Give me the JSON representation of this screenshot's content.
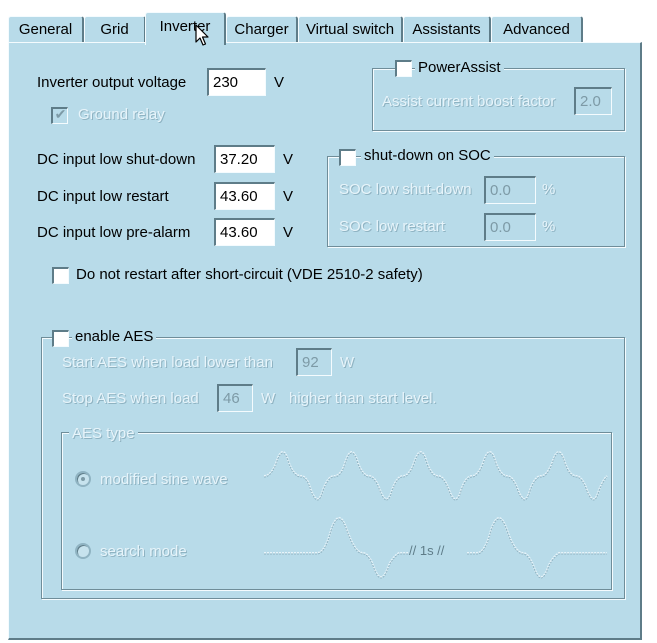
{
  "tabs": [
    {
      "label": "General"
    },
    {
      "label": "Grid"
    },
    {
      "label": "Inverter"
    },
    {
      "label": "Charger"
    },
    {
      "label": "Virtual switch"
    },
    {
      "label": "Assistants"
    },
    {
      "label": "Advanced"
    }
  ],
  "active_tab": "Inverter",
  "inverter": {
    "output_voltage_label": "Inverter output voltage",
    "output_voltage_value": "230",
    "output_voltage_unit": "V",
    "ground_relay_label": "Ground relay",
    "dc_shutdown_label": "DC input low shut-down",
    "dc_shutdown_value": "37.20",
    "dc_restart_label": "DC input low restart",
    "dc_restart_value": "43.60",
    "dc_prealarm_label": "DC input low pre-alarm",
    "dc_prealarm_value": "43.60",
    "dc_unit": "V",
    "no_restart_label": "Do not restart after short-circuit (VDE 2510-2  safety)"
  },
  "power_assist": {
    "label": "PowerAssist",
    "boost_label": "Assist current boost factor",
    "boost_value": "2.0"
  },
  "soc": {
    "label": "shut-down on SOC",
    "low_shutdown_label": "SOC low shut-down",
    "low_shutdown_value": "0.0",
    "low_restart_label": "SOC low restart",
    "low_restart_value": "0.0",
    "unit": "%"
  },
  "aes": {
    "label": "enable AES",
    "start_label": "Start AES when load lower than",
    "start_value": "92",
    "start_unit": "W",
    "stop_label": "Stop AES when load",
    "stop_value": "46",
    "stop_unit": "W",
    "stop_suffix": "higher than start level.",
    "type_label": "AES type",
    "modified_sine_label": "modified sine wave",
    "search_mode_label": "search mode",
    "search_gap_label": "// 1s //"
  },
  "colors": {
    "panel": "#b8dbe9",
    "disabled_text": "#e7f4fa",
    "shadow": "#5e7c88"
  }
}
